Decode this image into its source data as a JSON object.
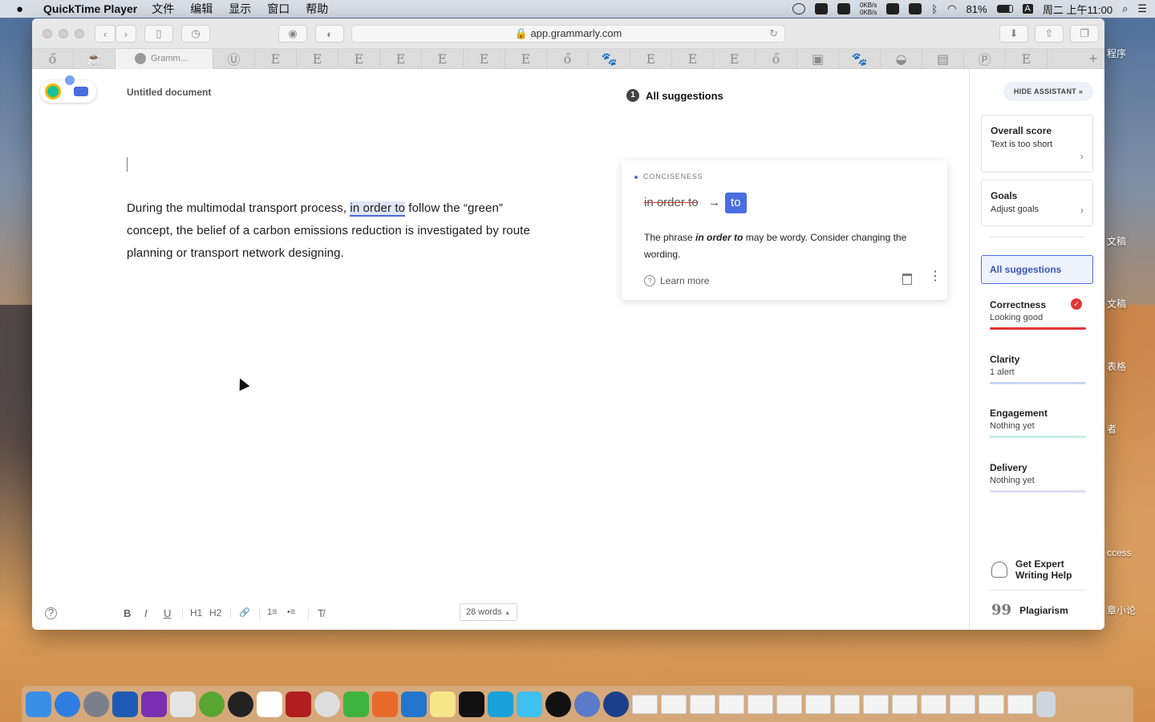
{
  "menubar": {
    "app_name": "QuickTime Player",
    "items": [
      "文件",
      "编辑",
      "显示",
      "窗口",
      "帮助"
    ],
    "net_up": "0KB/s",
    "net_down": "0KB/s",
    "battery": "81%",
    "input_method": "A",
    "clock": "周二 上午11:00"
  },
  "browser": {
    "url": "app.grammarly.com",
    "active_tab": "Gramm...",
    "tab_glyphs": [
      "ő",
      "☕",
      "Ⓤ",
      "E",
      "E",
      "E",
      "E",
      "E",
      "E",
      "E",
      "ő",
      "🐾",
      "E",
      "E",
      "E",
      "ő",
      "▣",
      "🐾",
      "◒",
      "▤",
      "Ⓟ",
      "E",
      "▣"
    ]
  },
  "editor": {
    "doc_title": "Untitled document",
    "text_before": "During the multimodal transport process, ",
    "text_highlight": "in order to",
    "text_after": " follow the “green” concept, the belief of a carbon emissions reduction is investigated by route planning or transport network designing.",
    "word_count": "28 words",
    "toolbar": {
      "help": "?",
      "bold": "B",
      "italic": "I",
      "underline": "U",
      "h1": "H1",
      "h2": "H2",
      "link": "🔗",
      "ordered_list": "1≡",
      "bullet_list": "•≡",
      "clear_format": "T̸"
    }
  },
  "suggestions": {
    "count": "1",
    "heading": "All suggestions",
    "card": {
      "category": "CONCISENESS",
      "original": "in order to",
      "arrow": "→",
      "replacement": "to",
      "desc_before": "The phrase ",
      "desc_phrase": "in order to",
      "desc_after": " may be wordy. Consider changing the wording.",
      "learn_more": "Learn more",
      "more": "⋮"
    }
  },
  "sidebar": {
    "hide_assistant": "HIDE ASSISTANT »",
    "overall": {
      "title": "Overall score",
      "sub": "Text is too short",
      "chevron": "›"
    },
    "goals": {
      "title": "Goals",
      "sub": "Adjust goals",
      "chevron": "›"
    },
    "all_suggestions": "All suggestions",
    "categories": [
      {
        "title": "Correctness",
        "sub": "Looking good",
        "color": "#e03535",
        "check": "✓"
      },
      {
        "title": "Clarity",
        "sub": "1 alert",
        "color": "#4a6ee0"
      },
      {
        "title": "Engagement",
        "sub": "Nothing yet",
        "color": "#15c39a"
      },
      {
        "title": "Delivery",
        "sub": "Nothing yet",
        "color": "#8e6bd8"
      }
    ],
    "expert_line1": "Get Expert",
    "expert_line2": "Writing Help",
    "plagiarism": "Plagiarism",
    "plag_icon": "99"
  },
  "desktop": {
    "fragments": [
      "程序",
      "文稿",
      "文稿",
      "表格",
      "者",
      "ccess",
      "章小论"
    ]
  },
  "colors": {
    "accent": "#4a6ee0",
    "highlight_bg": "#dde6f7",
    "correctness": "#e03535"
  }
}
